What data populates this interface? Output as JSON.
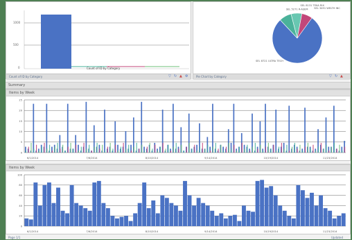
{
  "top_left_chart": {
    "legend_label": "Count of ID by Category",
    "footer_label": "Count of ID by Category",
    "series_colors": {
      "main": "#4a72c4",
      "a": "#4ab29a",
      "b": "#c2477a"
    }
  },
  "pie_chart": {
    "footer_label": "Pie Chart by Category",
    "slices": [
      {
        "label": "SEL 8721 ULTRA TECH",
        "value": 78,
        "color": "#4a72c4"
      },
      {
        "label": "SEL 5271 R-ASEM",
        "value": 8,
        "color": "#4ab29a"
      },
      {
        "label": "SEL 8131 TEKA RIX",
        "value": 7,
        "color": "#68c7b1"
      },
      {
        "label": "SEL 3491 WELTH INC",
        "value": 7,
        "color": "#c2477a"
      }
    ]
  },
  "section_bar": {
    "label": "Summary"
  },
  "chart2": {
    "title": "Items by Week",
    "yticks": [
      "0",
      "5",
      "10",
      "15",
      "20",
      "25"
    ],
    "xticks": [
      "6/1/2014",
      "7/6/2014",
      "8/10/2014",
      "9/14/2014",
      "10/19/2014",
      "11/23/2014"
    ]
  },
  "chart3": {
    "title": "Items by Week",
    "yticks": [
      "0",
      "20",
      "40",
      "60",
      "80",
      "100"
    ],
    "xticks": [
      "6/1/2014",
      "7/6/2014",
      "8/10/2014",
      "9/14/2014",
      "10/19/2014",
      "11/23/2014"
    ]
  },
  "status": {
    "left": "Page 1/1",
    "right": "Updated"
  },
  "icons": {
    "filter": "filter-icon",
    "refresh": "refresh-icon",
    "warn": "alert-icon",
    "more": "more-icon"
  },
  "chart_data": [
    {
      "type": "bar",
      "series": [
        {
          "name": "Count",
          "values": [
            3,
            2,
            1,
            25,
            1,
            2,
            4,
            3,
            25,
            1,
            3,
            4,
            2,
            9,
            3,
            1,
            25,
            2,
            2,
            9,
            4,
            1,
            3,
            26,
            2,
            1,
            14,
            3,
            4,
            1,
            22,
            2,
            3,
            1,
            16,
            4,
            2,
            3,
            11,
            2,
            4,
            18,
            1,
            2,
            26,
            3,
            2,
            4,
            1,
            5,
            2,
            3,
            22,
            1,
            4,
            2,
            25,
            2,
            3,
            13,
            1,
            3,
            20,
            2,
            3,
            4,
            15,
            2,
            2,
            8,
            3,
            25,
            2,
            1,
            4,
            3,
            2,
            12,
            5,
            25,
            2,
            3,
            10,
            4,
            3,
            2,
            20,
            1,
            3,
            16,
            2,
            25,
            3,
            2,
            4,
            22,
            2,
            3,
            5,
            1,
            24,
            2,
            4,
            3,
            1,
            2,
            23,
            3,
            3,
            1,
            2,
            12,
            4,
            2,
            18,
            3,
            3,
            24,
            2,
            1,
            3,
            6
          ]
        }
      ],
      "ylim": [
        0,
        27
      ]
    },
    {
      "type": "bar",
      "series": [
        {
          "name": "Items",
          "values": [
            15,
            13,
            85,
            40,
            80,
            85,
            45,
            75,
            30,
            25,
            80,
            45,
            40,
            35,
            30,
            85,
            88,
            45,
            35,
            20,
            15,
            18,
            20,
            10,
            25,
            45,
            85,
            35,
            50,
            25,
            60,
            55,
            45,
            40,
            30,
            88,
            60,
            40,
            55,
            45,
            40,
            30,
            20,
            25,
            15,
            20,
            22,
            10,
            40,
            30,
            28,
            88,
            90,
            75,
            78,
            60,
            40,
            30,
            20,
            15,
            80,
            70,
            55,
            65,
            40,
            60,
            35,
            30,
            15,
            20,
            25
          ]
        }
      ],
      "ylim": [
        0,
        100
      ]
    }
  ]
}
